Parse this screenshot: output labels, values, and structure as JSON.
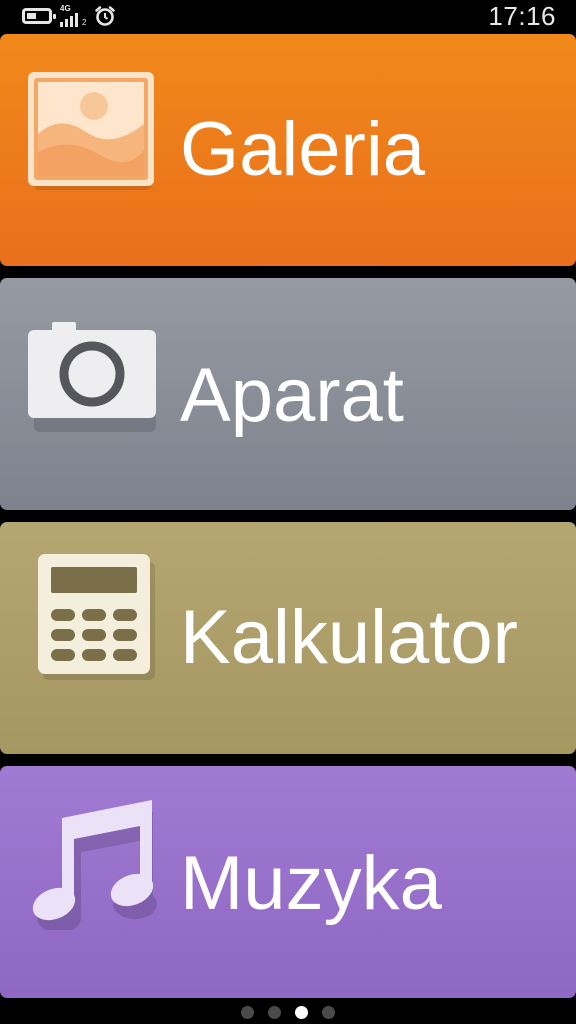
{
  "status_bar": {
    "network_type": "4G",
    "sim_slot": "2",
    "time": "17:16",
    "battery_level": 0.45
  },
  "tiles": [
    {
      "label": "Galeria",
      "icon": "gallery-icon",
      "color": "#ee7f1b"
    },
    {
      "label": "Aparat",
      "icon": "camera-icon",
      "color": "#8a8e98"
    },
    {
      "label": "Kalkulator",
      "icon": "calculator-icon",
      "color": "#ae9f6a"
    },
    {
      "label": "Muzyka",
      "icon": "music-note-icon",
      "color": "#9871cb"
    }
  ],
  "page_indicator": {
    "page_count": 4,
    "current_page": 3
  }
}
